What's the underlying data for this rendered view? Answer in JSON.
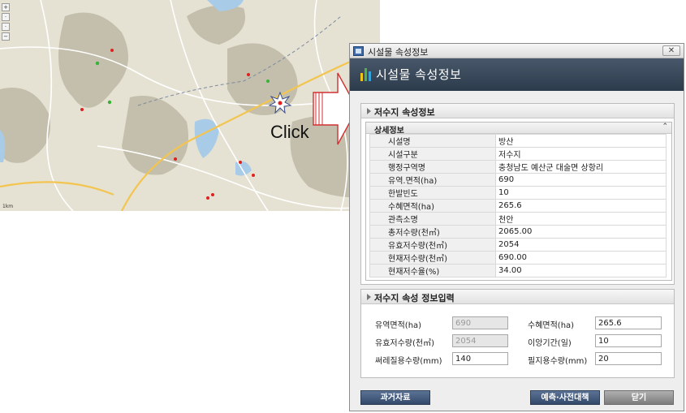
{
  "map": {
    "click_label": "Click",
    "scale_label": "1km",
    "colors": {
      "base": "#e8e4d6",
      "terrain": "#b9b6a4",
      "water": "#9dc3e6",
      "road": "#ffffff",
      "highway": "#f4c64f",
      "marker_red": "#e02020",
      "marker_green": "#36b336"
    }
  },
  "dialog": {
    "window_title": "시설물 속성정보",
    "close_glyph": "✕",
    "heading": "시설물 속성정보",
    "reservoir_section": {
      "title": "저수지 속성정보",
      "detail_title": "상세정보",
      "collapse_glyph": "⌃",
      "rows": [
        {
          "key": "시설명",
          "value": "방산"
        },
        {
          "key": "시설구분",
          "value": "저수지"
        },
        {
          "key": "행정구역명",
          "value": "충청남도 예산군 대술면 상항리"
        },
        {
          "key": "유역.면적(ha)",
          "value": "690"
        },
        {
          "key": "한발빈도",
          "value": "10"
        },
        {
          "key": "수혜면적(ha)",
          "value": "265.6"
        },
        {
          "key": "관측소명",
          "value": "천안"
        },
        {
          "key": "총저수량(천㎥)",
          "value": "2065.00"
        },
        {
          "key": "유효저수량(천㎥)",
          "value": "2054"
        },
        {
          "key": "현재저수량(천㎥)",
          "value": "690.00"
        },
        {
          "key": "현재저수율(%)",
          "value": "34.00"
        }
      ]
    },
    "input_section": {
      "title": "저수지 속성 정보입력",
      "fields": {
        "watershed_area": {
          "label": "유역면적(ha)",
          "value": "690"
        },
        "benefit_area": {
          "label": "수혜면적(ha)",
          "value": "265.6"
        },
        "effective_storage": {
          "label": "유효저수량(천㎥)",
          "value": "2054"
        },
        "transplant_period": {
          "label": "이앙기간(일)",
          "value": "10"
        },
        "puddling_water": {
          "label": "써레질용수량(mm)",
          "value": "140"
        },
        "required_water": {
          "label": "필지용수량(mm)",
          "value": "20"
        }
      }
    },
    "buttons": {
      "history": "과거자료",
      "forecast": "예측·사전대책",
      "close": "닫기"
    },
    "colors": {
      "header_band": "#33424f",
      "button_blue": "#3f5678",
      "button_gray": "#8e8e8e"
    }
  }
}
